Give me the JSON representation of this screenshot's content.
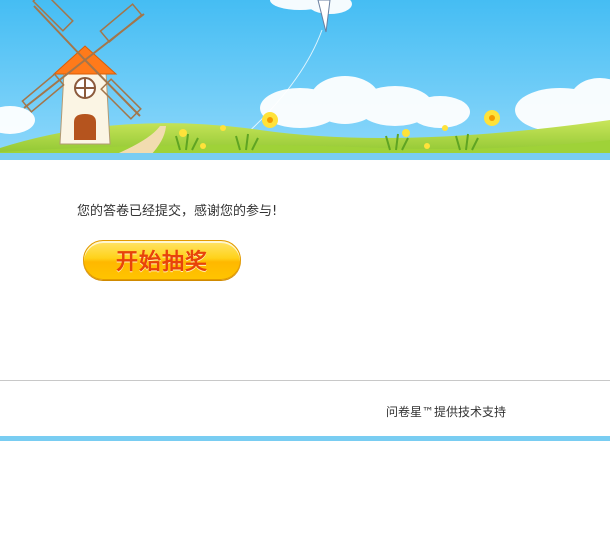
{
  "message": {
    "thanks": "您的答卷已经提交，感谢您的参与!"
  },
  "actions": {
    "lottery_label": "开始抽奖"
  },
  "footer": {
    "support_text": "问卷星™提供技术支持"
  },
  "colors": {
    "sky": "#5cc6f6",
    "grass": "#a6d63a",
    "bottom_bar": "#79cdf2",
    "button": "#ffc400",
    "button_text": "#e8430a"
  }
}
